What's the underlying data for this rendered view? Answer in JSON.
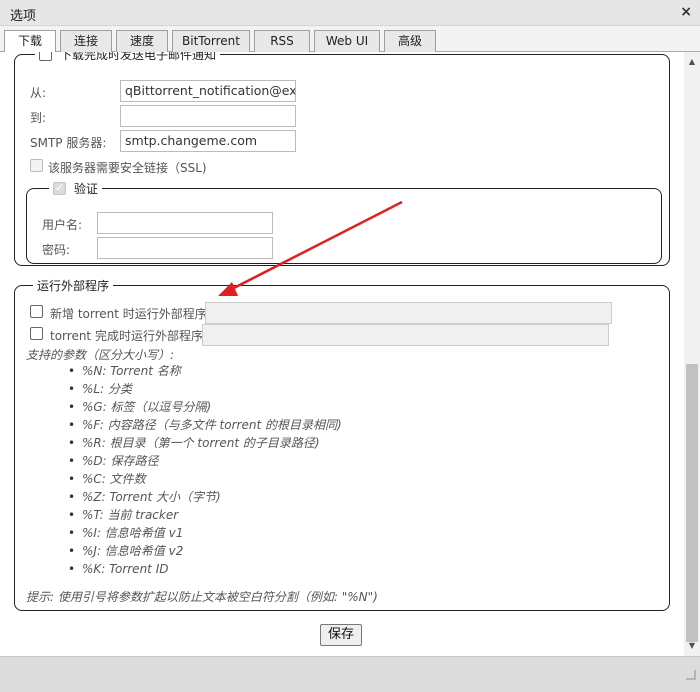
{
  "window": {
    "title": "选项",
    "close_symbol": "×"
  },
  "tabs": [
    {
      "label": "下载",
      "active": true
    },
    {
      "label": "连接"
    },
    {
      "label": "速度"
    },
    {
      "label": "BitTorrent"
    },
    {
      "label": "RSS"
    },
    {
      "label": "Web UI"
    },
    {
      "label": "高级"
    }
  ],
  "email": {
    "legend": "下载完成时发送电子邮件通知",
    "from_label": "从:",
    "from_value": "qBittorrent_notification@example.com",
    "to_label": "到:",
    "to_value": "",
    "smtp_label": "SMTP 服务器:",
    "smtp_value": "smtp.changeme.com",
    "ssl_label": "该服务器需要安全链接（SSL)",
    "auth": {
      "legend": "验证",
      "user_label": "用户名:",
      "user_value": "",
      "pass_label": "密码:",
      "pass_value": ""
    }
  },
  "external": {
    "legend": "运行外部程序",
    "on_add_label": "新增 torrent 时运行外部程序",
    "on_add_value": "",
    "on_finish_label": "torrent 完成时运行外部程序",
    "on_finish_value": "",
    "params_title": "支持的参数（区分大小写）:",
    "params": [
      "%N: Torrent 名称",
      "%L: 分类",
      "%G: 标签（以逗号分隔)",
      "%F: 内容路径（与多文件 torrent 的根目录相同)",
      "%R: 根目录（第一个 torrent 的子目录路径)",
      "%D: 保存路径",
      "%C: 文件数",
      "%Z: Torrent 大小（字节)",
      "%T: 当前 tracker",
      "%I: 信息哈希值 v1",
      "%J: 信息哈希值 v2",
      "%K: Torrent ID"
    ],
    "hint": "提示: 使用引号将参数扩起以防止文本被空白符分割（例如: \"%N\")"
  },
  "save_label": "保存",
  "colors": {
    "arrow": "#e02020"
  }
}
